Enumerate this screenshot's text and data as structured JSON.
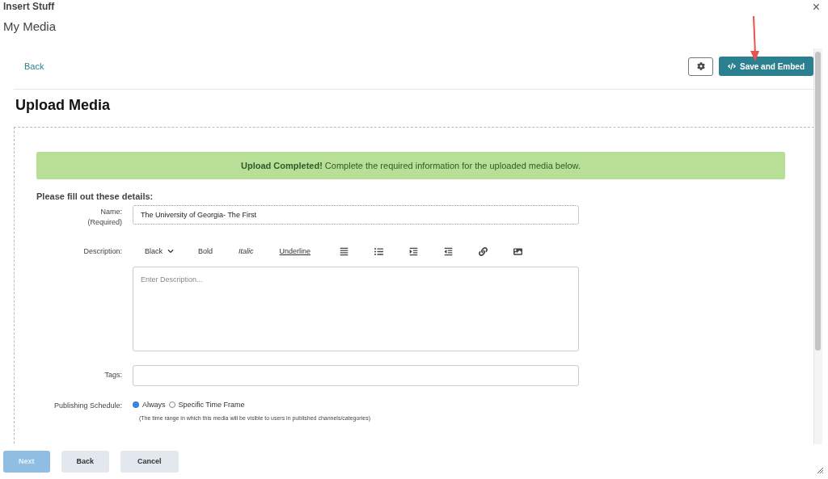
{
  "window": {
    "title": "Insert Stuff",
    "subtitle": "My Media",
    "close": "×"
  },
  "top_bar": {
    "back_link": "Back",
    "save_button": "Save and Embed"
  },
  "page_title": "Upload Media",
  "banner": "**Upload Completed!** Complete the required information for the uploaded media below.",
  "form": {
    "heading": "Please fill out these details:",
    "name": {
      "label": "Name:",
      "note": "(Required)",
      "value": "The University of Georgia- The First"
    },
    "description": {
      "label": "Description:",
      "placeholder": "Enter Description...",
      "toolbar": [
        {
          "kind": "dropdown",
          "label": "Black"
        },
        {
          "kind": "bold",
          "label": "Bold"
        },
        {
          "kind": "italic",
          "label": "Italic"
        },
        {
          "kind": "underline",
          "label": "Underline"
        },
        {
          "kind": "align"
        },
        {
          "kind": "list"
        },
        {
          "kind": "indent"
        },
        {
          "kind": "outdent"
        },
        {
          "kind": "link"
        },
        {
          "kind": "image"
        }
      ]
    },
    "tags": {
      "label": "Tags:"
    },
    "schedule": {
      "label": "Publishing Schedule:",
      "options": [
        {
          "label": "Always",
          "selected": true
        },
        {
          "label": "Specific Time Frame",
          "selected": false
        }
      ],
      "hint": "(The time range in which this media will be visible to users in published channels/categories)"
    }
  },
  "footer": [
    {
      "label": "Next",
      "disabled": true
    },
    {
      "label": "Back",
      "disabled": false
    },
    {
      "label": "Cancel",
      "disabled": false
    }
  ]
}
